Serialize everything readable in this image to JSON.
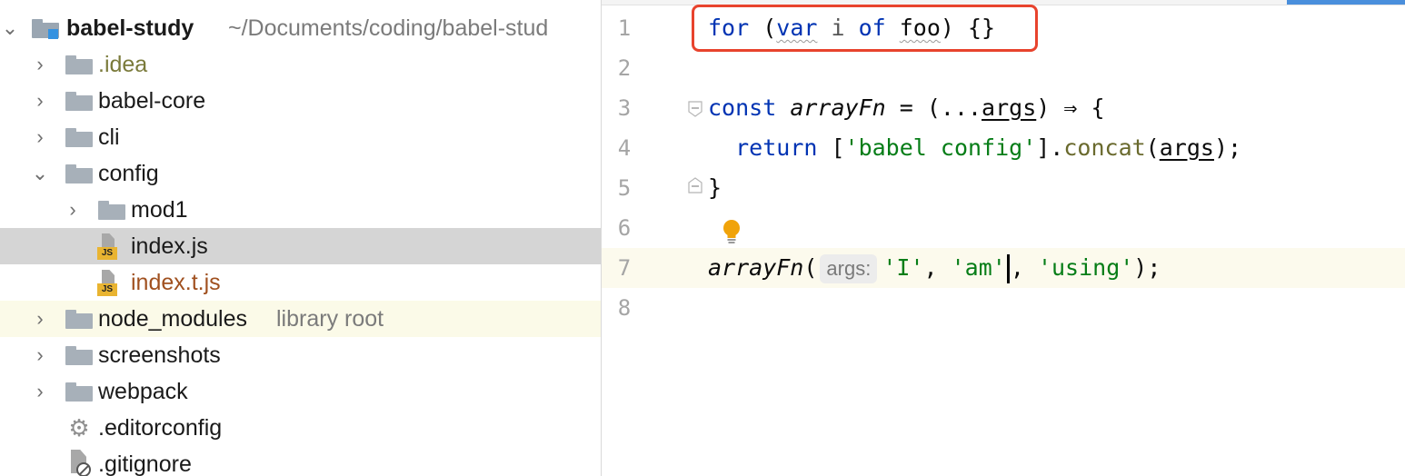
{
  "tree": {
    "root": {
      "name": "babel-study",
      "path": "~/Documents/coding/babel-stud"
    },
    "items": [
      {
        "label": ".idea"
      },
      {
        "label": "babel-core"
      },
      {
        "label": "cli"
      },
      {
        "label": "config"
      },
      {
        "label": "mod1"
      },
      {
        "label": "index.js"
      },
      {
        "label": "index.t.js"
      },
      {
        "label": "node_modules",
        "suffix": "library root"
      },
      {
        "label": "screenshots"
      },
      {
        "label": "webpack"
      },
      {
        "label": ".editorconfig"
      },
      {
        "label": ".gitignore"
      }
    ]
  },
  "editor": {
    "line_numbers": [
      "1",
      "2",
      "3",
      "4",
      "5",
      "6",
      "7",
      "8"
    ],
    "line1": {
      "kw_for": "for",
      "p_open": " (",
      "kw_var": "var",
      "i": " i ",
      "kw_of": "of",
      "foo": "foo",
      "rest": ") {}"
    },
    "line3": {
      "kw_const": "const",
      "sp": " ",
      "fn": "arrayFn",
      "eq": " = (...",
      "param": "args",
      "arrow": ") ⇒ {"
    },
    "line4": {
      "indent": "  ",
      "kw_return": "return",
      "open": " [",
      "str": "'babel config'",
      "close": "].",
      "method": "concat",
      "po": "(",
      "param": "args",
      "pc": ");"
    },
    "line5": {
      "text": "}"
    },
    "line7": {
      "fn": "arrayFn",
      "po": "(",
      "hint": "args:",
      "s1": "'I'",
      "c1": ", ",
      "s2": "'am'",
      "c2": ", ",
      "s3": "'using'",
      "end": ");"
    }
  },
  "colors": {
    "keyword": "#0033b3",
    "string": "#067d17",
    "highlight_box": "#e8432d",
    "current_line": "#fcfaed",
    "selected_row": "#d5d5d5"
  }
}
